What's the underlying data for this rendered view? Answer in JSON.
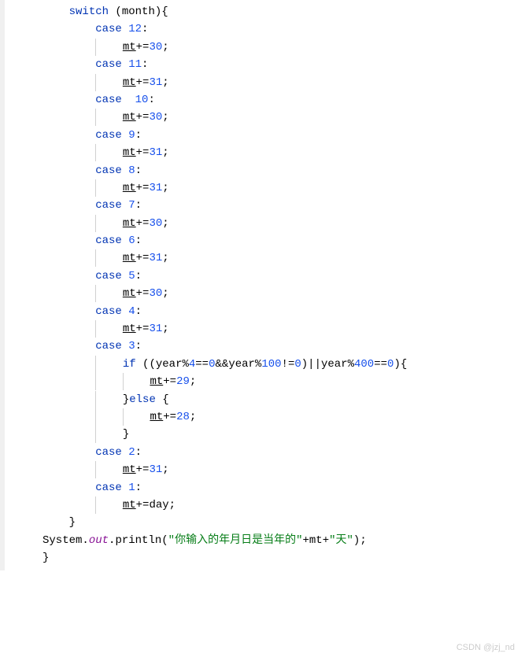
{
  "code": {
    "switch_kw": "switch",
    "switch_var": "month",
    "case_kw": "case",
    "if_kw": "if",
    "else_kw": "else",
    "mt_var": "mt",
    "day_var": "day",
    "year_var": "year",
    "cases": {
      "c12": {
        "label": "12",
        "val": "30"
      },
      "c11": {
        "label": "11",
        "val": "31"
      },
      "c10": {
        "label": " 10",
        "val": "30"
      },
      "c9": {
        "label": "9",
        "val": "31"
      },
      "c8": {
        "label": "8",
        "val": "31"
      },
      "c7": {
        "label": "7",
        "val": "30"
      },
      "c6": {
        "label": "6",
        "val": "31"
      },
      "c5": {
        "label": "5",
        "val": "30"
      },
      "c4": {
        "label": "4",
        "val": "31"
      },
      "c3": {
        "label": "3",
        "if_true": "29",
        "if_false": "28"
      },
      "c2": {
        "label": "2",
        "val": "31"
      },
      "c1": {
        "label": "1"
      }
    },
    "leap_cond": {
      "n4": "4",
      "n0a": "0",
      "n100": "100",
      "n0b": "0",
      "n400": "400",
      "n0c": "0"
    },
    "print": {
      "sys": "System",
      "out": "out",
      "println": "println",
      "str1": "\"你输入的年月日是当年的\"",
      "plus_var": "mt",
      "str2": "\"天\""
    }
  },
  "watermark": "CSDN @jzj_nd"
}
